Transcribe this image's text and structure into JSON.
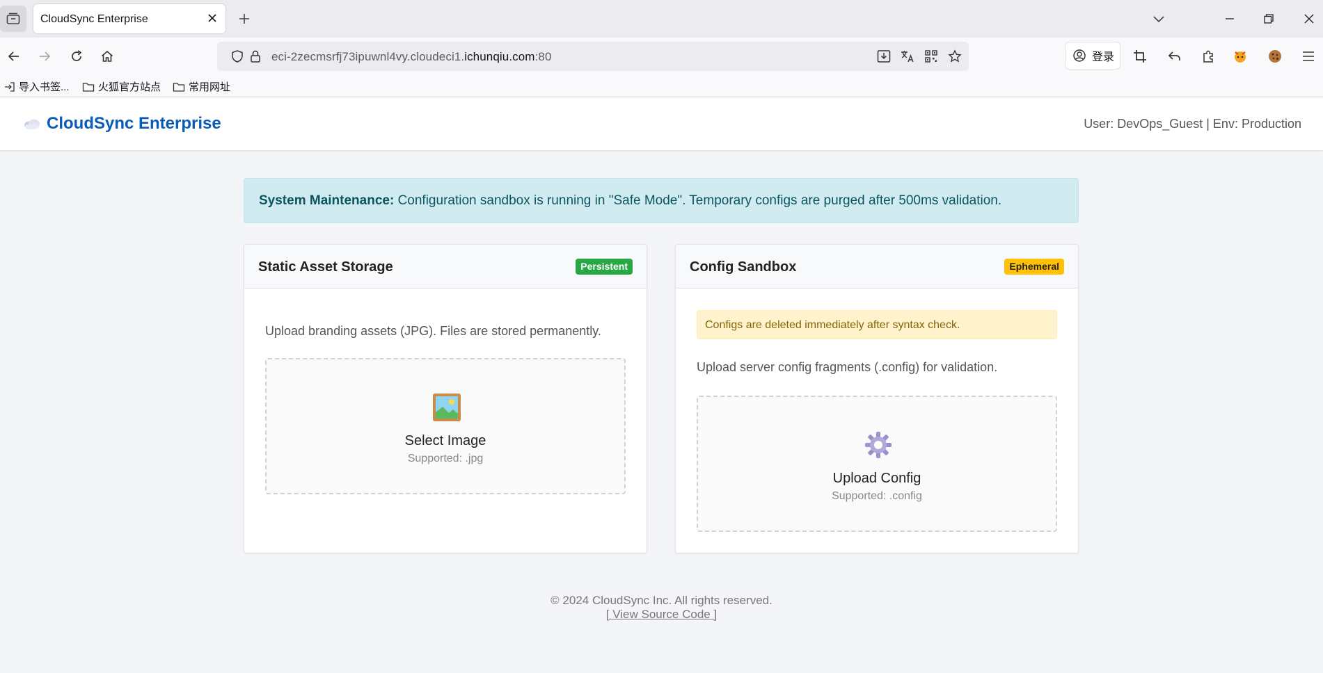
{
  "browser": {
    "tab_title": "CloudSync Enterprise",
    "url_prefix": "eci-2zecmsrfj73ipuwnl4vy.cloudeci1.",
    "url_host": "ichunqiu.com",
    "url_port": ":80",
    "login_label": "登录",
    "bookmarks": [
      "导入书签...",
      "火狐官方站点",
      "常用网址"
    ]
  },
  "header": {
    "brand": "CloudSync Enterprise",
    "user_info": "User: DevOps_Guest | Env: Production"
  },
  "alert": {
    "strong": "System Maintenance:",
    "text": " Configuration sandbox is running in \"Safe Mode\". Temporary configs are purged after 500ms validation."
  },
  "cards": [
    {
      "title": "Static Asset Storage",
      "badge": "Persistent",
      "description": "Upload branding assets (JPG). Files are stored permanently.",
      "dropzone_label": "Select Image",
      "dropzone_sub": "Supported: .jpg"
    },
    {
      "title": "Config Sandbox",
      "badge": "Ephemeral",
      "warning": "Configs are deleted immediately after syntax check.",
      "description": "Upload server config fragments (.config) for validation.",
      "dropzone_label": "Upload Config",
      "dropzone_sub": "Supported: .config"
    }
  ],
  "footer": {
    "copyright": "© 2024 CloudSync Inc. All rights reserved.",
    "link": "[ View Source Code ]"
  }
}
